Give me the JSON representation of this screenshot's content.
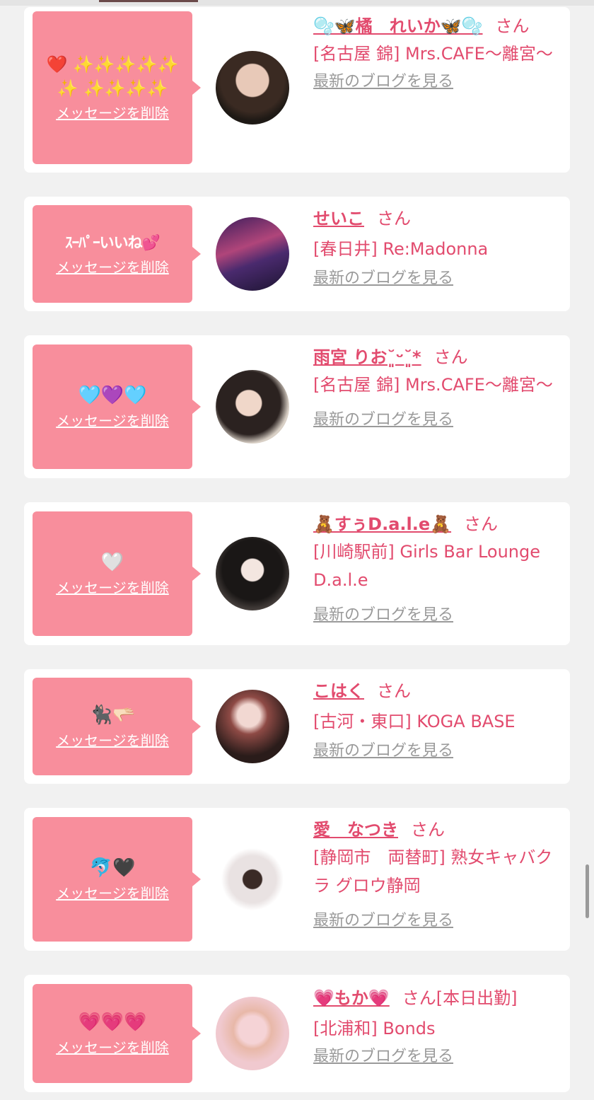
{
  "colors": {
    "accent": "#e24b6e",
    "bubble": "#f88e9c",
    "link_gray": "#9a9a9a",
    "page_bg": "#f1f1f1"
  },
  "cards": [
    {
      "message": "❤️ ✨✨✨✨✨✨ ✨✨✨✨",
      "delete_label": "メッセージを削除",
      "name": "🫧🦋橘　れいか🦋🫧",
      "honorific": "さん",
      "extra": "",
      "shop": "[名古屋 錦] Mrs.CAFE～離宮～",
      "blog_label": "最新のブログを見る",
      "avatar_icon": "profile-photo"
    },
    {
      "message": "ｽｰﾊﾟｰいいね💕",
      "delete_label": "メッセージを削除",
      "name": "せいこ",
      "honorific": "さん",
      "extra": "",
      "shop": "[春日井] Re:Madonna",
      "blog_label": "最新のブログを見る",
      "avatar_icon": "profile-photo"
    },
    {
      "message": "🩵💜🩵",
      "delete_label": "メッセージを削除",
      "name": "雨宮 りお˘͈ᵕ˘͈*",
      "honorific": "さん",
      "extra": "",
      "shop": "[名古屋 錦] Mrs.CAFE～離宮～",
      "blog_label": "最新のブログを見る",
      "avatar_icon": "profile-photo"
    },
    {
      "message": "🤍",
      "delete_label": "メッセージを削除",
      "name": "🧸すぅD.a.l.e🧸",
      "honorific": "さん",
      "extra": "",
      "shop": "[川崎駅前] Girls Bar Lounge D.a.l.e",
      "blog_label": "最新のブログを見る",
      "avatar_icon": "profile-photo"
    },
    {
      "message": "🐈‍⬛🫳🏻",
      "delete_label": "メッセージを削除",
      "name": "こはく",
      "honorific": "さん",
      "extra": "",
      "shop": "[古河・東口] KOGA BASE",
      "blog_label": "最新のブログを見る",
      "avatar_icon": "profile-photo"
    },
    {
      "message": "🐬🖤",
      "delete_label": "メッセージを削除",
      "name": "愛　なつき",
      "honorific": "さん",
      "extra": "",
      "shop": "[静岡市　両替町] 熟女キャバクラ グロウ静岡",
      "blog_label": "最新のブログを見る",
      "avatar_icon": "profile-photo"
    },
    {
      "message": "💗💗💗",
      "delete_label": "メッセージを削除",
      "name": "💗もか💗",
      "honorific": "さん",
      "extra": "[本日出勤]",
      "shop": "[北浦和] Bonds",
      "blog_label": "最新のブログを見る",
      "avatar_icon": "profile-photo"
    }
  ]
}
